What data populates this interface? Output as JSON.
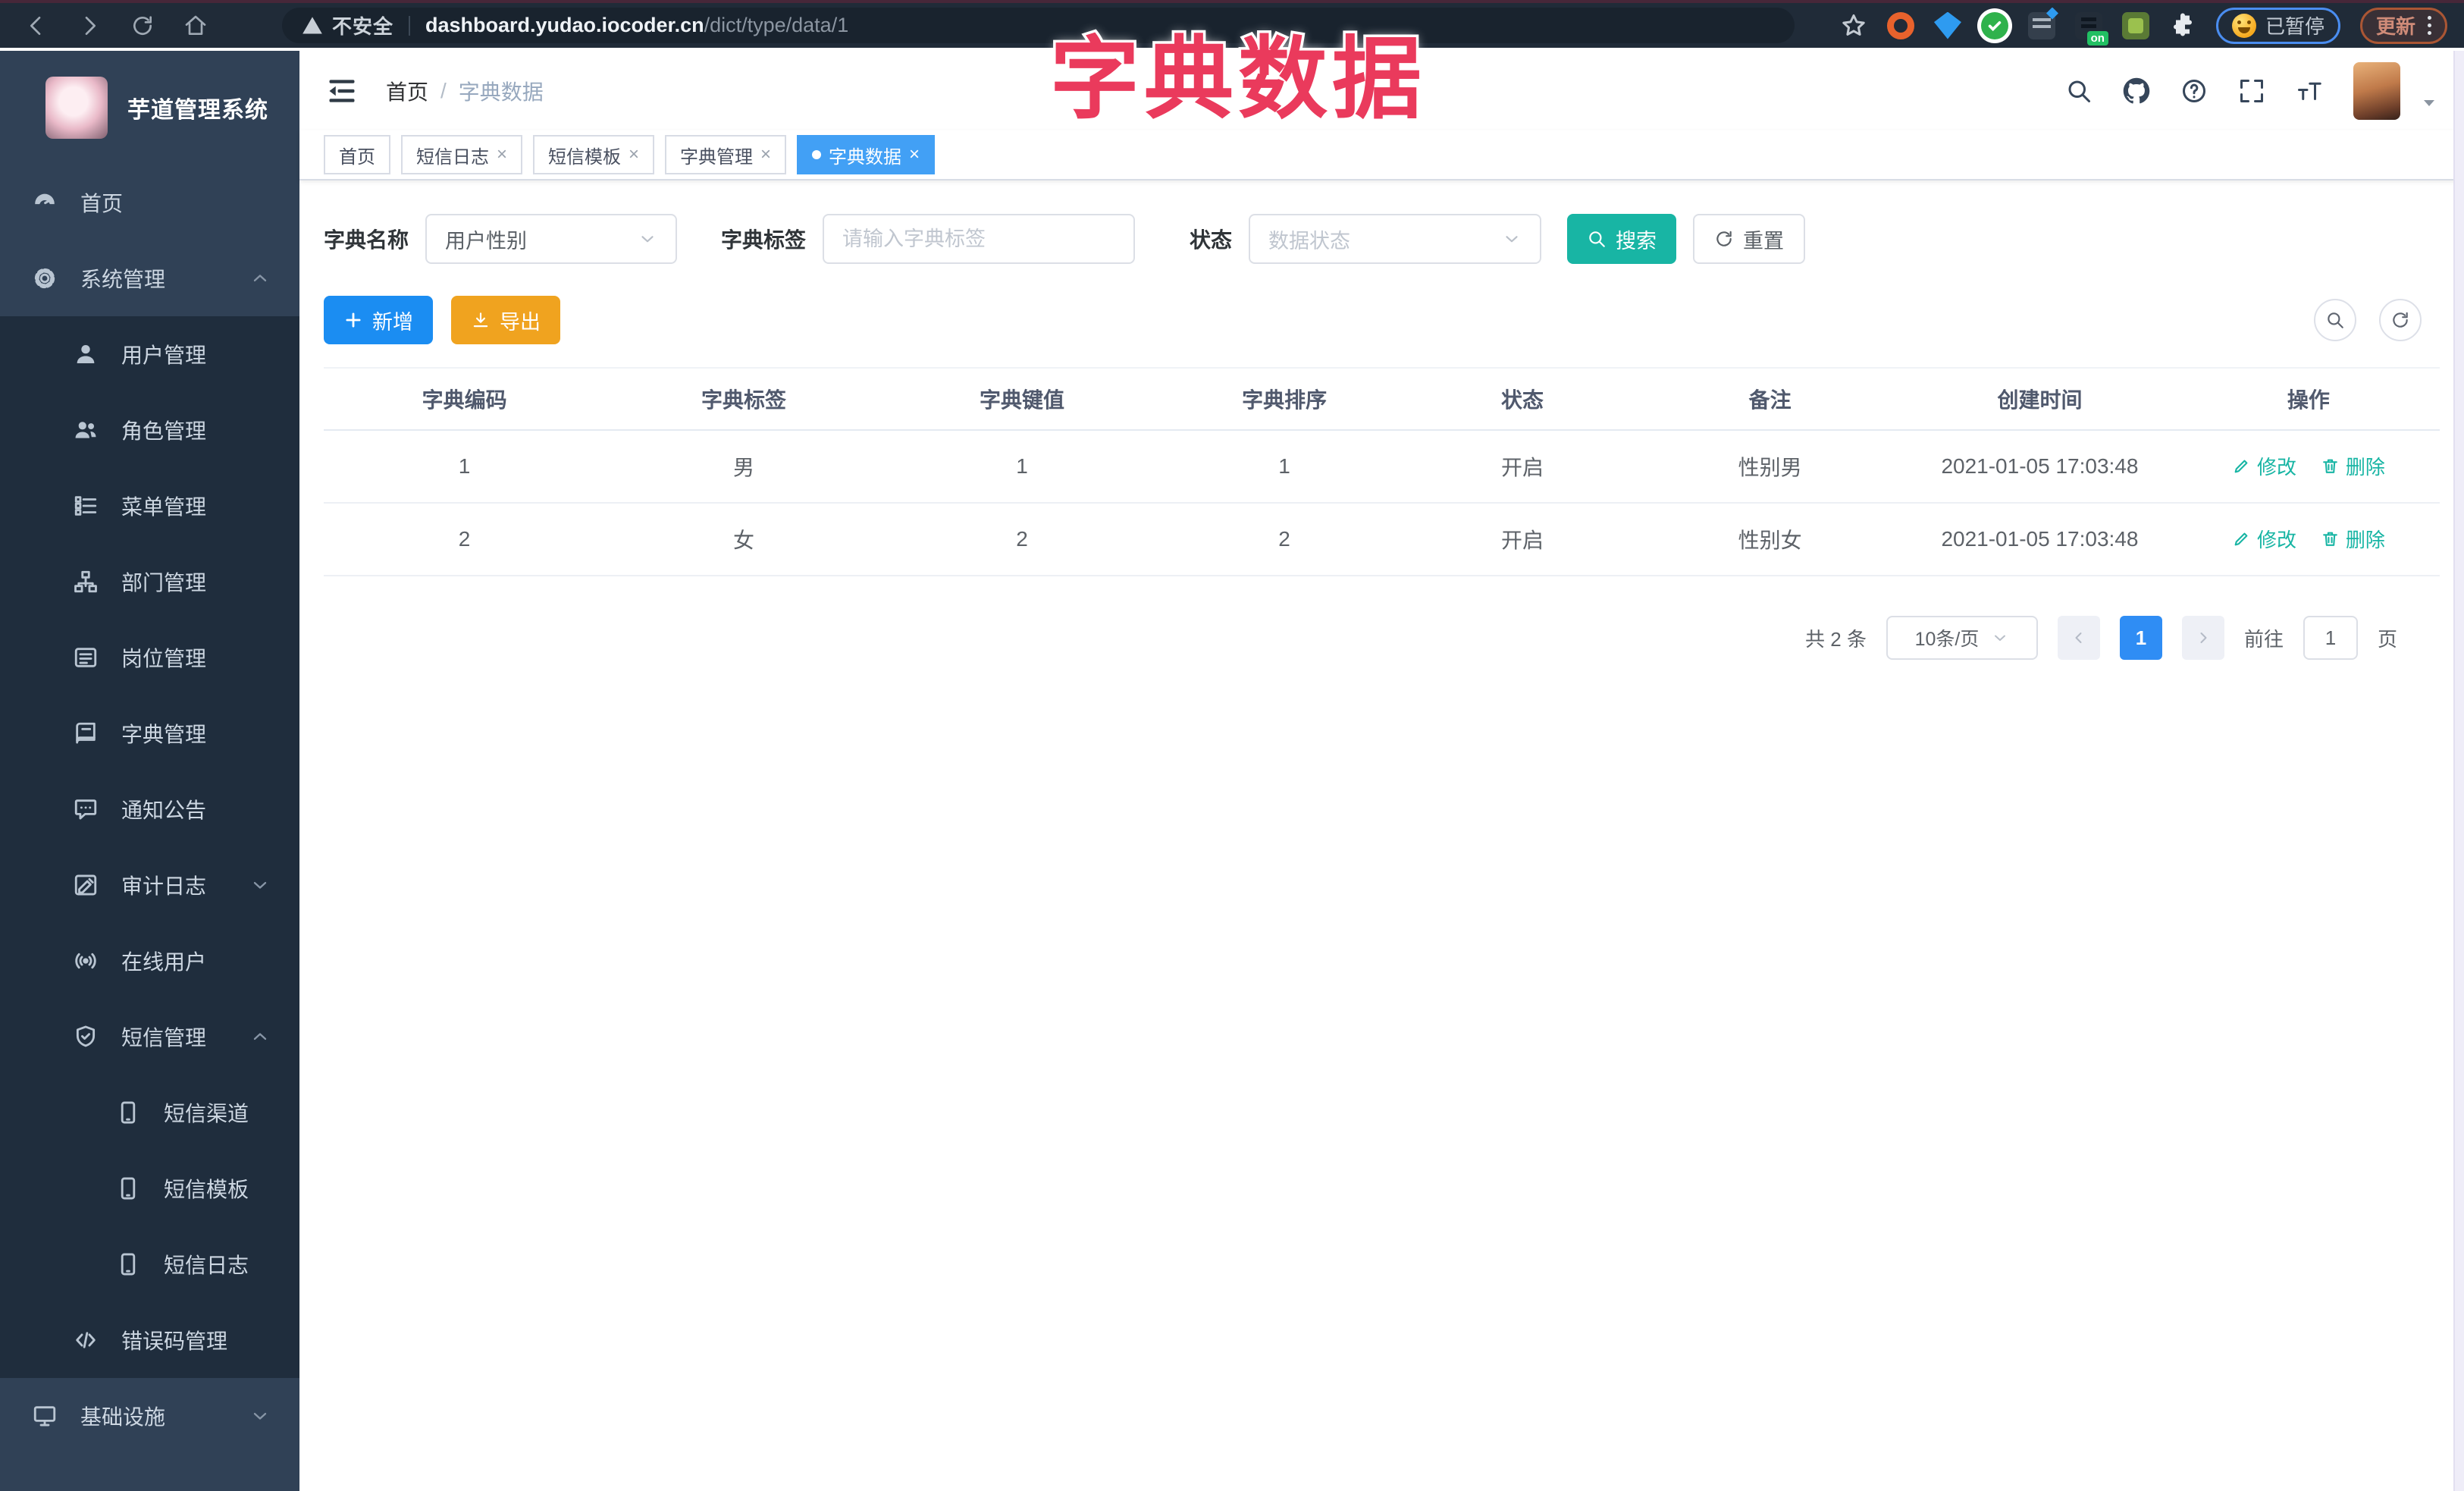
{
  "browser": {
    "security_label": "不安全",
    "url_host": "dashboard.yudao.iocoder.cn",
    "url_path": "/dict/type/data/1",
    "paused_label": "已暂停",
    "update_label": "更新"
  },
  "overlay_title": "字典数据",
  "sidebar": {
    "logo_title": "芋道管理系统",
    "items": [
      {
        "label": "首页",
        "icon": "dashboard",
        "level": "top",
        "arrow": ""
      },
      {
        "label": "系统管理",
        "icon": "gear",
        "level": "top",
        "arrow": "up"
      },
      {
        "label": "用户管理",
        "icon": "user",
        "level": "sub",
        "arrow": ""
      },
      {
        "label": "角色管理",
        "icon": "peoples",
        "level": "sub",
        "arrow": ""
      },
      {
        "label": "菜单管理",
        "icon": "tree-table",
        "level": "sub",
        "arrow": ""
      },
      {
        "label": "部门管理",
        "icon": "tree",
        "level": "sub",
        "arrow": ""
      },
      {
        "label": "岗位管理",
        "icon": "post",
        "level": "sub",
        "arrow": ""
      },
      {
        "label": "字典管理",
        "icon": "dict",
        "level": "sub",
        "arrow": ""
      },
      {
        "label": "通知公告",
        "icon": "message",
        "level": "sub",
        "arrow": ""
      },
      {
        "label": "审计日志",
        "icon": "log",
        "level": "sub",
        "arrow": "down"
      },
      {
        "label": "在线用户",
        "icon": "online",
        "level": "sub",
        "arrow": ""
      },
      {
        "label": "短信管理",
        "icon": "shield",
        "level": "sub",
        "arrow": "up"
      },
      {
        "label": "短信渠道",
        "icon": "phone",
        "level": "sub2",
        "arrow": ""
      },
      {
        "label": "短信模板",
        "icon": "phone",
        "level": "sub2",
        "arrow": ""
      },
      {
        "label": "短信日志",
        "icon": "phone",
        "level": "sub2",
        "arrow": ""
      },
      {
        "label": "错误码管理",
        "icon": "code",
        "level": "sub",
        "arrow": ""
      },
      {
        "label": "基础设施",
        "icon": "monitor",
        "level": "top",
        "arrow": "down"
      }
    ]
  },
  "header": {
    "breadcrumb_home": "首页",
    "breadcrumb_sep": "/",
    "breadcrumb_current": "字典数据"
  },
  "tabs": [
    {
      "label": "首页"
    },
    {
      "label": "短信日志"
    },
    {
      "label": "短信模板"
    },
    {
      "label": "字典管理"
    },
    {
      "label": "字典数据"
    }
  ],
  "filters": {
    "dict_name_label": "字典名称",
    "dict_name_value": "用户性别",
    "dict_label_label": "字典标签",
    "dict_label_placeholder": "请输入字典标签",
    "status_label": "状态",
    "status_placeholder": "数据状态",
    "search_label": "搜索",
    "reset_label": "重置"
  },
  "toolbar": {
    "add_label": "新增",
    "export_label": "导出"
  },
  "table": {
    "headers": [
      "字典编码",
      "字典标签",
      "字典键值",
      "字典排序",
      "状态",
      "备注",
      "创建时间",
      "操作"
    ],
    "rows": [
      {
        "code": "1",
        "label": "男",
        "value": "1",
        "sort": "1",
        "status": "开启",
        "remark": "性别男",
        "created": "2021-01-05 17:03:48"
      },
      {
        "code": "2",
        "label": "女",
        "value": "2",
        "sort": "2",
        "status": "开启",
        "remark": "性别女",
        "created": "2021-01-05 17:03:48"
      }
    ],
    "edit_label": "修改",
    "delete_label": "删除"
  },
  "pagination": {
    "total_label": "共 2 条",
    "page_size": "10条/页",
    "current_page": "1",
    "goto_label": "前往",
    "goto_value": "1",
    "page_suffix": "页"
  },
  "colors": {
    "primary_blue": "#1b8df2",
    "teal": "#18b5a4",
    "orange": "#f0a31f",
    "annotation_pink": "#ea3a5c",
    "sidebar_bg": "#304156",
    "submenu_bg": "#1f2d3d"
  }
}
